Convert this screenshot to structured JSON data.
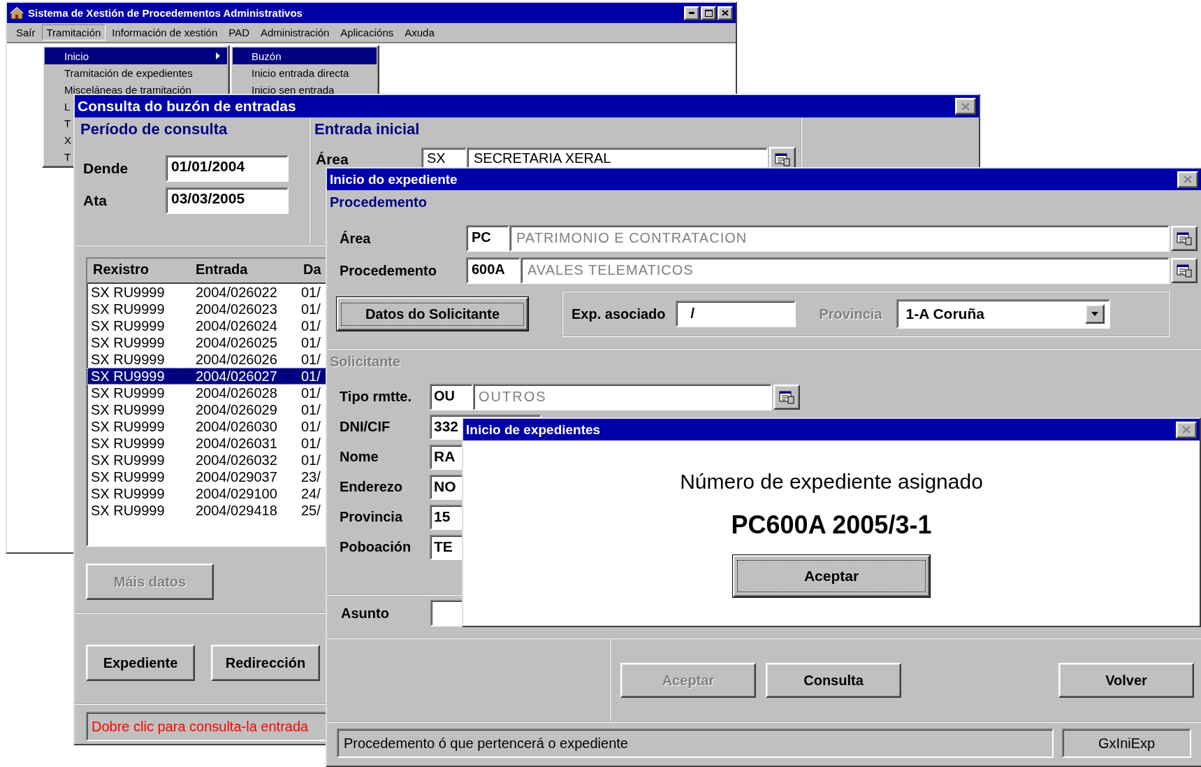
{
  "main_window": {
    "title": "Sistema de Xestión de Procedementos Administrativos",
    "menu": [
      {
        "label": "Saír",
        "selected": false
      },
      {
        "label": "Tramitación",
        "selected": true
      },
      {
        "label": "Información de xestión",
        "selected": false
      },
      {
        "label": "PAD",
        "selected": false
      },
      {
        "label": "Administración",
        "selected": false
      },
      {
        "label": "Aplicacións",
        "selected": false
      },
      {
        "label": "Axuda",
        "selected": false
      }
    ],
    "dropdown": [
      {
        "label": "Inicio",
        "selected": true,
        "submenu": true
      },
      {
        "label": "Tramitación de expedientes",
        "selected": false,
        "submenu": false
      },
      {
        "label": "Misceláneas de tramitación",
        "selected": false,
        "submenu": false
      },
      {
        "label": "L",
        "selected": false
      },
      {
        "label": "T",
        "selected": false
      },
      {
        "label": "X",
        "selected": false
      },
      {
        "label": "T",
        "selected": false
      }
    ],
    "submenu": [
      {
        "label": "Buzón",
        "selected": true
      },
      {
        "label": "Inicio entrada directa",
        "selected": false
      },
      {
        "label": "Inicio sen entrada",
        "selected": false
      }
    ]
  },
  "consulta_window": {
    "title": "Consulta do buzón de entradas",
    "period": {
      "title": "Período de consulta",
      "fields": [
        {
          "label": "Dende",
          "value": "01/01/2004"
        },
        {
          "label": "Ata",
          "value": "03/03/2005"
        }
      ]
    },
    "entrada": {
      "title": "Entrada inicial",
      "label": "Área",
      "code": "SX",
      "name": "SECRETARIA XERAL"
    },
    "table": {
      "columns": [
        "Rexistro",
        "Entrada",
        "Da"
      ],
      "rows": [
        {
          "cells": [
            "SX RU9999",
            "2004/026022",
            "01/"
          ],
          "selected": false
        },
        {
          "cells": [
            "SX RU9999",
            "2004/026023",
            "01/"
          ],
          "selected": false
        },
        {
          "cells": [
            "SX RU9999",
            "2004/026024",
            "01/"
          ],
          "selected": false
        },
        {
          "cells": [
            "SX RU9999",
            "2004/026025",
            "01/"
          ],
          "selected": false
        },
        {
          "cells": [
            "SX RU9999",
            "2004/026026",
            "01/"
          ],
          "selected": false
        },
        {
          "cells": [
            "SX RU9999",
            "2004/026027",
            "01/"
          ],
          "selected": true
        },
        {
          "cells": [
            "SX RU9999",
            "2004/026028",
            "01/"
          ],
          "selected": false
        },
        {
          "cells": [
            "SX RU9999",
            "2004/026029",
            "01/"
          ],
          "selected": false
        },
        {
          "cells": [
            "SX RU9999",
            "2004/026030",
            "01/"
          ],
          "selected": false
        },
        {
          "cells": [
            "SX RU9999",
            "2004/026031",
            "01/"
          ],
          "selected": false
        },
        {
          "cells": [
            "SX RU9999",
            "2004/026032",
            "01/"
          ],
          "selected": false
        },
        {
          "cells": [
            "SX RU9999",
            "2004/029037",
            "23/"
          ],
          "selected": false
        },
        {
          "cells": [
            "SX RU9999",
            "2004/029100",
            "24/"
          ],
          "selected": false
        },
        {
          "cells": [
            "SX RU9999",
            "2004/029418",
            "25/"
          ],
          "selected": false
        }
      ]
    },
    "more_button": {
      "label": "Máis datos",
      "disabled": true
    },
    "buttons": [
      {
        "label": "Expediente",
        "disabled": false
      },
      {
        "label": "Redirección",
        "disabled": false
      }
    ],
    "status": "Dobre clic para consulta-la entrada"
  },
  "expediente_window": {
    "title": "Inicio do expediente",
    "procedemento": {
      "title": "Procedemento",
      "rows": [
        {
          "label": "Área",
          "code": "PC",
          "name": "PATRIMONIO E CONTRATACION"
        },
        {
          "label": "Procedemento",
          "code": "600A",
          "name": "AVALES TELEMATICOS"
        }
      ]
    },
    "datos_button": {
      "label": "Datos do Solicitante",
      "focused": true
    },
    "exp_asociado": {
      "label": "Exp. asociado",
      "value": "/"
    },
    "provincia": {
      "label": "Provincia",
      "disabled": true,
      "value": "1-A Coruña"
    },
    "solicitante": {
      "title": "Solicitante",
      "disabled": true,
      "tipo": {
        "label": "Tipo rmtte.",
        "code": "OU",
        "name": "OUTROS"
      },
      "rows": [
        {
          "label": "DNI/CIF",
          "value": "332"
        },
        {
          "label": "Nome",
          "value": "RA"
        },
        {
          "label": "Enderezo",
          "value": "NO"
        },
        {
          "label": "Provincia",
          "value": "15"
        },
        {
          "label": "Poboación",
          "value": "TE"
        }
      ]
    },
    "asunto": {
      "label": "Asunto"
    },
    "buttons": [
      {
        "label": "Aceptar",
        "disabled": true
      },
      {
        "label": "Consulta",
        "disabled": false
      },
      {
        "label": "Volver",
        "disabled": false
      }
    ],
    "status": "Procedemento ó que pertencerá o expediente",
    "status_code": "GxIniExp"
  },
  "dialog": {
    "title": "Inicio de expedientes",
    "message": "Número de expediente asignado",
    "number": "PC600A 2005/3-1",
    "button": {
      "label": "Aceptar",
      "focused": true
    }
  }
}
